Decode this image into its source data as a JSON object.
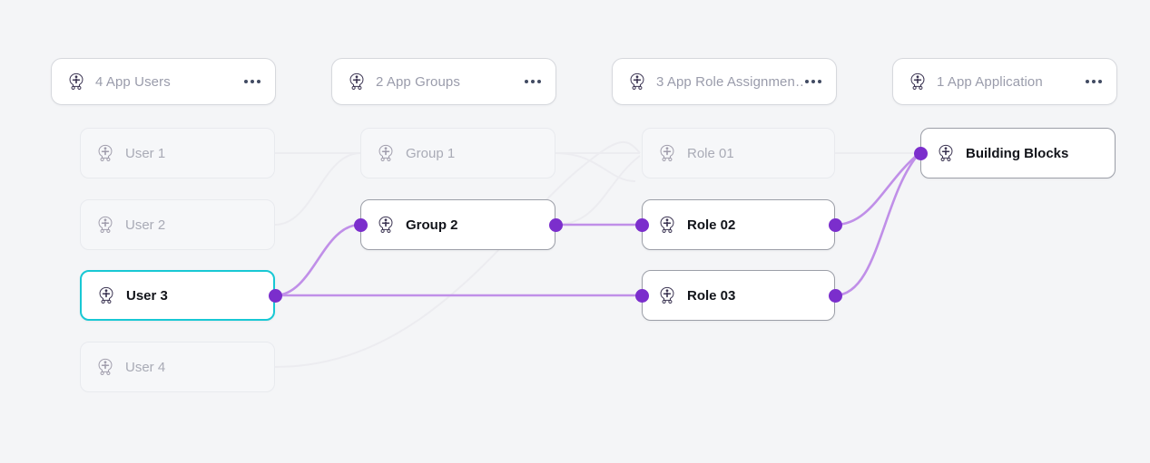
{
  "canvas": {
    "background": "#f4f5f7",
    "accent_selected": "#18c8d4",
    "handle_color": "#7b2ecc",
    "edge_color": "#c08fe8",
    "edge_color_faded": "#ececf0"
  },
  "columns": [
    {
      "id": "app-users",
      "header": {
        "label": "4 App Users",
        "icon": "identity-icon",
        "menu_icon": "more-options-icon"
      },
      "nodes": [
        {
          "id": "user-1",
          "label": "User 1",
          "state": "dim",
          "icon": "identity-icon"
        },
        {
          "id": "user-2",
          "label": "User 2",
          "state": "dim",
          "icon": "identity-icon"
        },
        {
          "id": "user-3",
          "label": "User 3",
          "state": "selected",
          "icon": "identity-icon"
        },
        {
          "id": "user-4",
          "label": "User 4",
          "state": "dim",
          "icon": "identity-icon"
        }
      ]
    },
    {
      "id": "app-groups",
      "header": {
        "label": "2 App Groups",
        "icon": "identity-icon",
        "menu_icon": "more-options-icon"
      },
      "nodes": [
        {
          "id": "group-1",
          "label": "Group 1",
          "state": "dim",
          "icon": "identity-icon"
        },
        {
          "id": "group-2",
          "label": "Group 2",
          "state": "active",
          "icon": "identity-icon"
        }
      ]
    },
    {
      "id": "app-role-assignments",
      "header": {
        "label": "3 App Role Assignmen…",
        "icon": "identity-icon",
        "menu_icon": "more-options-icon"
      },
      "nodes": [
        {
          "id": "role-01",
          "label": "Role 01",
          "state": "dim",
          "icon": "identity-icon"
        },
        {
          "id": "role-02",
          "label": "Role 02",
          "state": "active",
          "icon": "identity-icon"
        },
        {
          "id": "role-03",
          "label": "Role 03",
          "state": "active",
          "icon": "identity-icon"
        }
      ]
    },
    {
      "id": "app-application",
      "header": {
        "label": "1 App Application",
        "icon": "identity-icon",
        "menu_icon": "more-options-icon"
      },
      "nodes": [
        {
          "id": "building-blocks",
          "label": "Building Blocks",
          "state": "active",
          "icon": "identity-icon"
        }
      ]
    }
  ]
}
